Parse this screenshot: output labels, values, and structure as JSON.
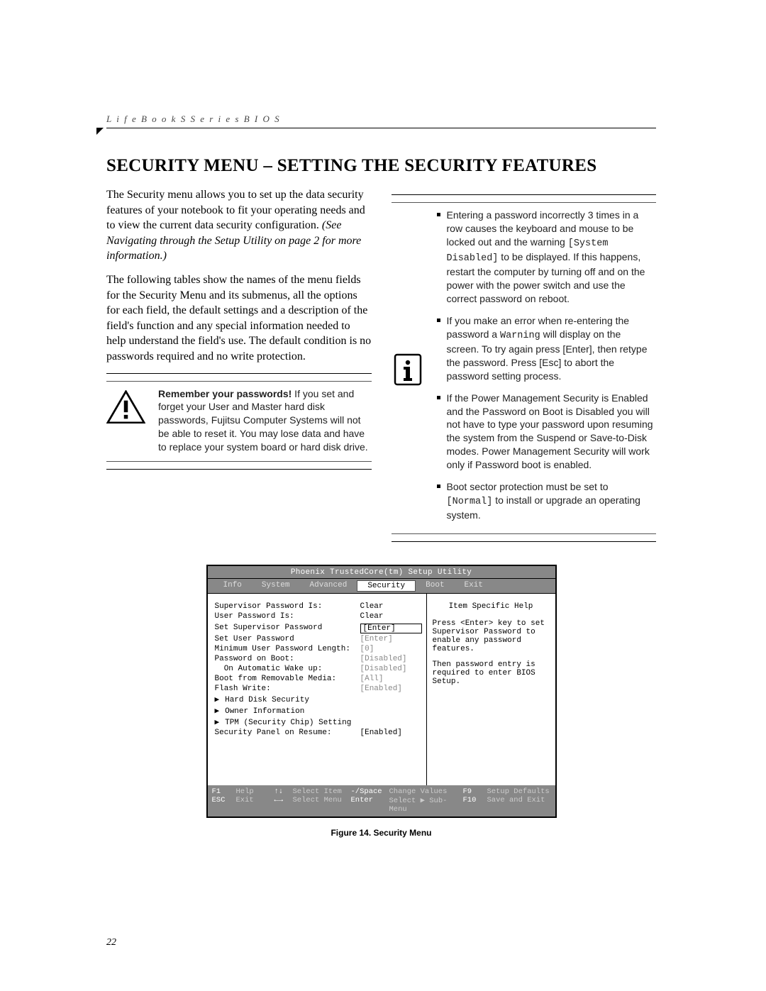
{
  "header": "L i f e B o o k   S   S e r i e s   B I O S",
  "title": "SECURITY MENU – SETTING THE SECURITY FEATURES",
  "intro1a": "The Security menu allows you to set up the data security features of your notebook to fit your operating needs and to view the current data security configuration. ",
  "intro1b": "(See Navigating through the Setup Utility on page 2 for more information.)",
  "intro2": "The following tables show the names of the menu fields for the Security Menu and its submenus, all the options for each field, the default settings and a description of the field's function and any special information needed to help understand the field's use. The default condition is no passwords required and no write protection.",
  "warn_bold": "Remember your passwords!",
  "warn_text": " If you set and forget your User and Master hard disk passwords, Fujitsu Computer Systems will not be able to reset it. You may lose data and have to replace your system board or hard disk drive.",
  "info_items": [
    {
      "pre": "Entering a password incorrectly 3 times in a row causes the keyboard and mouse to be locked out and the warning ",
      "code": "[System Disabled]",
      "post": " to be displayed. If this happens, restart the computer by turning off and on the power with the power switch and use the correct password on reboot."
    },
    {
      "pre": "If you make an error when re-entering the password a ",
      "code": "Warning",
      "post": " will display on the screen. To try again press [Enter], then retype the password. Press [Esc] to abort the password setting process."
    },
    {
      "pre": "If the Power Management Security is Enabled and the Password on Boot is Disabled you will not have to type your password upon resuming the system from the Suspend or Save-to-Disk modes. Power Management Security will work only if Password boot is enabled.",
      "code": "",
      "post": ""
    },
    {
      "pre": "Boot sector protection must be set to ",
      "code": "[Normal]",
      "post": " to install or upgrade an operating system."
    }
  ],
  "bios": {
    "title": "Phoenix TrustedCore(tm) Setup Utility",
    "tabs": [
      "Info",
      "System",
      "Advanced",
      "Security",
      "Boot",
      "Exit"
    ],
    "active_tab": "Security",
    "help_title": "Item Specific Help",
    "help_body1": "Press <Enter> key to set Supervisor Password to enable any password features.",
    "help_body2": "Then password entry is required to enter BIOS Setup.",
    "rows": [
      {
        "label": "Supervisor Password Is:",
        "value": "Clear",
        "cls": "black"
      },
      {
        "label": "User Password Is:",
        "value": "Clear",
        "cls": "black"
      },
      {
        "label": "",
        "value": "",
        "cls": ""
      },
      {
        "label": "Set Supervisor Password",
        "value": "[Enter]",
        "cls": "sel"
      },
      {
        "label": "Set User Password",
        "value": "[Enter]",
        "cls": ""
      },
      {
        "label": "Minimum User Password Length:",
        "value": "[0]",
        "cls": ""
      },
      {
        "label": "Password on Boot:",
        "value": "[Disabled]",
        "cls": ""
      },
      {
        "label": "  On Automatic Wake up:",
        "value": "[Disabled]",
        "cls": ""
      },
      {
        "label": "Boot from Removable Media:",
        "value": "[All]",
        "cls": ""
      },
      {
        "label": "Flash Write:",
        "value": "[Enabled]",
        "cls": ""
      }
    ],
    "subs": [
      "Hard Disk Security",
      "Owner Information",
      "TPM (Security Chip) Setting"
    ],
    "row_last": {
      "label": "Security Panel on Resume:",
      "value": "[Enabled]",
      "cls": "black"
    },
    "footer": {
      "r1_k1": "F1",
      "r1_d1": "Help",
      "r1_k2": "↑↓",
      "r1_d2": "Select Item",
      "r1_k3": "-/Space",
      "r1_d3": "Change Values",
      "r1_k4": "F9",
      "r1_d4": "Setup Defaults",
      "r2_k1": "ESC",
      "r2_d1": "Exit",
      "r2_k2": "←→",
      "r2_d2": "Select Menu",
      "r2_k3": "Enter",
      "r2_d3": "Select ▶ Sub-Menu",
      "r2_k4": "F10",
      "r2_d4": "Save and Exit"
    }
  },
  "figure_caption": "Figure 14.  Security Menu",
  "page_number": "22"
}
